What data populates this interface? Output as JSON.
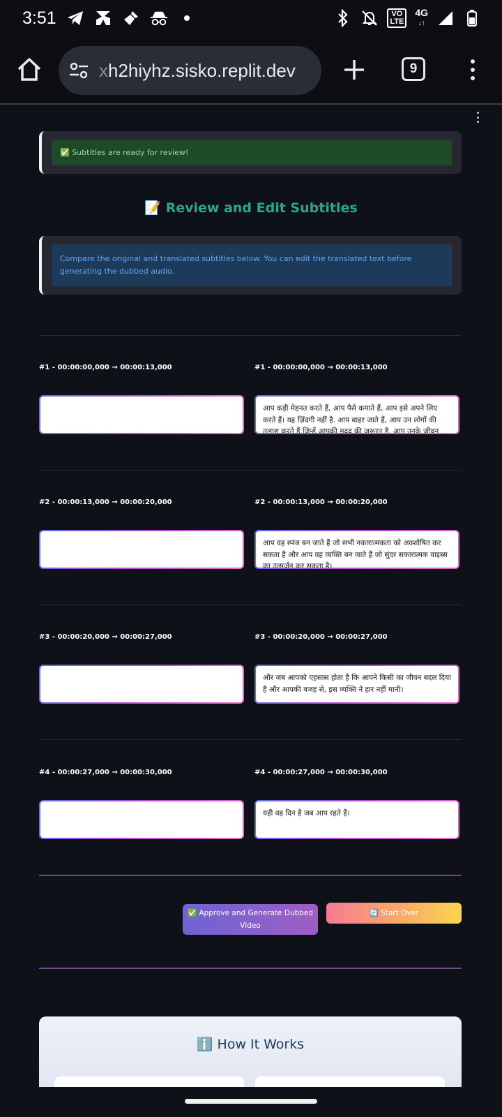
{
  "status_bar": {
    "time": "3:51",
    "volte_label": "VO\nLTE",
    "network_label": "4G"
  },
  "browser": {
    "url_prefix": "x",
    "url_rest": "h2hiyhz.sisko.replit.dev",
    "tab_count": "9"
  },
  "alerts": {
    "success": "✅ Subtitles are ready for review!",
    "info": "Compare the original and translated subtitles below. You can edit the translated text before generating the dubbed audio."
  },
  "section_title": "📝 Review and Edit Subtitles",
  "subtitles": [
    {
      "original_ts": "#1 - 00:00:00,000 → 00:00:13,000",
      "translated_ts": "#1 - 00:00:00,000 → 00:00:13,000",
      "original_text": "",
      "translated_text": "आप कड़ी मेहनत करते हैं, आप पैसे कमाते हैं, आप इसे अपने लिए करते हैं। यह ज़िंदगी नहीं है. आप बाहर जाते हैं, आप उन लोगों की तलाश करते हैं जिन्हें आपकी मदद की ज़रूरत है. आप उनके जीवन"
    },
    {
      "original_ts": "#2 - 00:00:13,000 → 00:00:20,000",
      "translated_ts": "#2 - 00:00:13,000 → 00:00:20,000",
      "original_text": "",
      "translated_text": "आप वह स्पंज बन जाते हैं जो सभी नकारात्मकता को अवशोषित कर सकता है और आप वह व्यक्ति बन जाते हैं जो सुंदर सकारात्मक वाइब्स का उत्सर्जन कर सकता है।"
    },
    {
      "original_ts": "#3 - 00:00:20,000 → 00:00:27,000",
      "translated_ts": "#3 - 00:00:20,000 → 00:00:27,000",
      "original_text": "",
      "translated_text": "और जब आपको एहसास होता है कि आपने किसी का जीवन बदल दिया है और आपकी वजह से, इस व्यक्ति ने हार नहीं मानी।"
    },
    {
      "original_ts": "#4 - 00:00:27,000 → 00:00:30,000",
      "translated_ts": "#4 - 00:00:27,000 → 00:00:30,000",
      "original_text": "",
      "translated_text": "यही वह दिन है जब आप रहते हैं।"
    }
  ],
  "buttons": {
    "approve": "✅ Approve and Generate Dubbed Video",
    "start_over": "🔄 Start Over"
  },
  "how_it_works": {
    "title": "ℹ️ How It Works"
  }
}
